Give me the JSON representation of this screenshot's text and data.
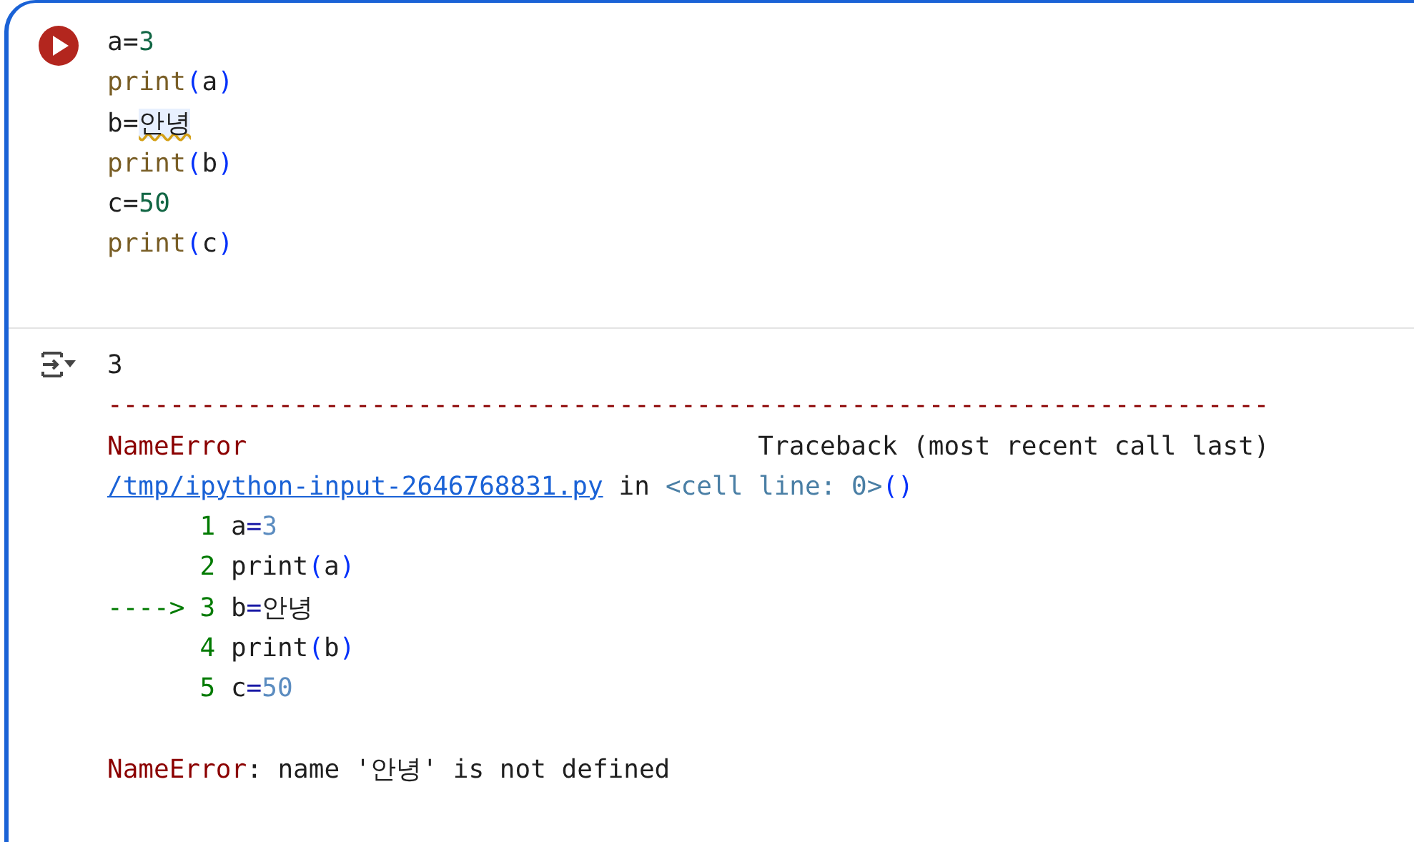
{
  "cell": {
    "code": [
      [
        {
          "text": "a=",
          "kind": "plain"
        },
        {
          "text": "3",
          "kind": "number"
        }
      ],
      [
        {
          "text": "print",
          "kind": "builtin"
        },
        {
          "text": "(",
          "kind": "paren"
        },
        {
          "text": "a",
          "kind": "plain"
        },
        {
          "text": ")",
          "kind": "paren"
        }
      ],
      [
        {
          "text": "b=",
          "kind": "plain"
        },
        {
          "text": "안녕",
          "kind": "undefined"
        }
      ],
      [
        {
          "text": "print",
          "kind": "builtin"
        },
        {
          "text": "(",
          "kind": "paren"
        },
        {
          "text": "b",
          "kind": "plain"
        },
        {
          "text": ")",
          "kind": "paren"
        }
      ],
      [
        {
          "text": "c=",
          "kind": "plain"
        },
        {
          "text": "50",
          "kind": "number"
        }
      ],
      [
        {
          "text": "print",
          "kind": "builtin"
        },
        {
          "text": "(",
          "kind": "paren"
        },
        {
          "text": "c",
          "kind": "plain"
        },
        {
          "text": ")",
          "kind": "paren"
        }
      ]
    ]
  },
  "output": {
    "stdout": "3",
    "traceback": {
      "rule": "---------------------------------------------------------------------------",
      "error_name": "NameError",
      "header": "Traceback (most recent call last)",
      "file": "/tmp/ipython-input-2646768831.py",
      "in_word": "in",
      "location": "<cell line: 0>",
      "call_parens": "()",
      "lines": [
        {
          "number": "1",
          "tokens": [
            {
              "text": "a",
              "kind": "plain"
            },
            {
              "text": "=",
              "kind": "op"
            },
            {
              "text": "3",
              "kind": "number"
            }
          ]
        },
        {
          "number": "2",
          "tokens": [
            {
              "text": "print",
              "kind": "plain"
            },
            {
              "text": "(",
              "kind": "paren"
            },
            {
              "text": "a",
              "kind": "plain"
            },
            {
              "text": ")",
              "kind": "paren"
            }
          ]
        },
        {
          "marker": "---->",
          "number": "3",
          "tokens": [
            {
              "text": "b",
              "kind": "plain"
            },
            {
              "text": "=",
              "kind": "op"
            },
            {
              "text": "안녕",
              "kind": "plain"
            }
          ]
        },
        {
          "number": "4",
          "tokens": [
            {
              "text": "print",
              "kind": "plain"
            },
            {
              "text": "(",
              "kind": "paren"
            },
            {
              "text": "b",
              "kind": "plain"
            },
            {
              "text": ")",
              "kind": "paren"
            }
          ]
        },
        {
          "number": "5",
          "tokens": [
            {
              "text": "c",
              "kind": "plain"
            },
            {
              "text": "=",
              "kind": "op"
            },
            {
              "text": "50",
              "kind": "number"
            }
          ]
        }
      ],
      "error_label": "NameError",
      "error_message": ": name '안녕' is not defined"
    }
  }
}
